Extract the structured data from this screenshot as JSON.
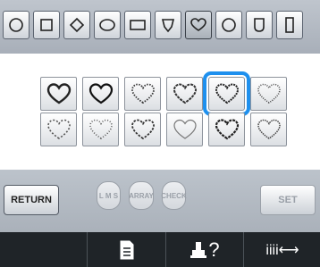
{
  "shape_toolbar": {
    "shapes": [
      {
        "icon": "circle-icon",
        "selected": false
      },
      {
        "icon": "square-icon",
        "selected": false
      },
      {
        "icon": "diamond-icon",
        "selected": false
      },
      {
        "icon": "oval-icon",
        "selected": false
      },
      {
        "icon": "rectangle-icon",
        "selected": false
      },
      {
        "icon": "shield-icon",
        "selected": false
      },
      {
        "icon": "heart-icon",
        "selected": true
      },
      {
        "icon": "octagon-circle-icon",
        "selected": false
      },
      {
        "icon": "shield-rounded-icon",
        "selected": false
      },
      {
        "icon": "tall-rectangle-icon",
        "selected": false
      }
    ]
  },
  "pattern_grid": {
    "rows": 2,
    "cols": 6,
    "selected_index": 4,
    "icon": "heart-stitch-icon"
  },
  "buttons": {
    "return_label": "RETURN",
    "lms_label": "L M S",
    "array_label": "ARRAY",
    "check_label": "CHECK",
    "set_label": "SET"
  },
  "footer": {
    "list_icon": "list-icon",
    "help_label": "?",
    "tension_label": "iiii⟷"
  },
  "colors": {
    "accent": "#1e90ee",
    "footer_bg": "#1f2428",
    "toolbar_bg": "#b4bbc4"
  }
}
